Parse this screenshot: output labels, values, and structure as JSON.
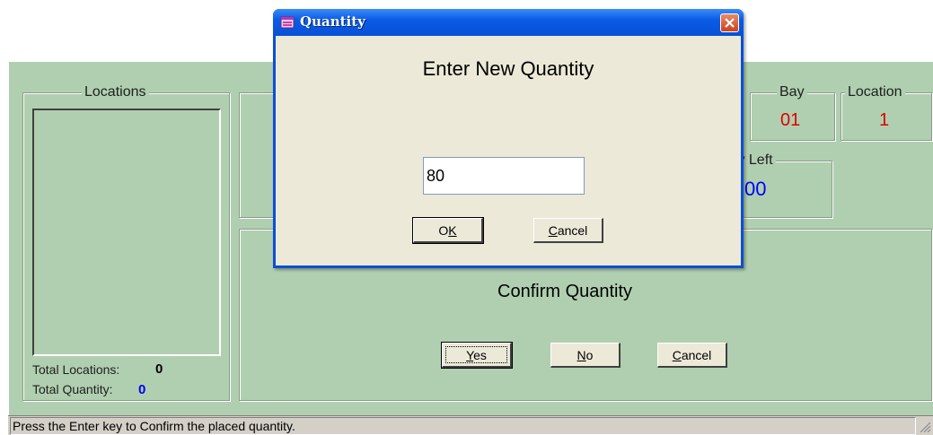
{
  "main": {
    "locations_legend": "Locations",
    "total_locations_label": "Total Locations:",
    "total_locations_value": "0",
    "total_quantity_label": "Total Quantity:",
    "total_quantity_value": "0",
    "bay_legend": "Bay",
    "bay_value": "01",
    "location_legend": "Location",
    "location_value": "1",
    "qty_left_legend": "ty Left",
    "qty_left_value": "00",
    "confirm_title": "Confirm Quantity",
    "yes_mnemonic": "Y",
    "yes_rest": "es",
    "no_mnemonic": "N",
    "no_rest": "o",
    "cancel_mnemonic": "C",
    "cancel_rest": "ancel"
  },
  "status": {
    "text": "Press the Enter key to Confirm the placed quantity."
  },
  "dialog": {
    "title": "Quantity",
    "heading": "Enter New Quantity",
    "input_value": "80",
    "ok_mnemonic": "K",
    "ok_prefix": "O",
    "cancel_mnemonic": "C",
    "cancel_rest": "ancel"
  },
  "colors": {
    "app_background": "#b0cfb0",
    "value_red": "#e00000",
    "value_blue": "#0000ff",
    "dialog_background": "#ece9d8",
    "titlebar_blue": "#0a5ce6"
  },
  "icons": {
    "title_icon": "app-window-icon",
    "close_icon": "close-x-icon",
    "grip_icon": "size-grip-icon"
  }
}
